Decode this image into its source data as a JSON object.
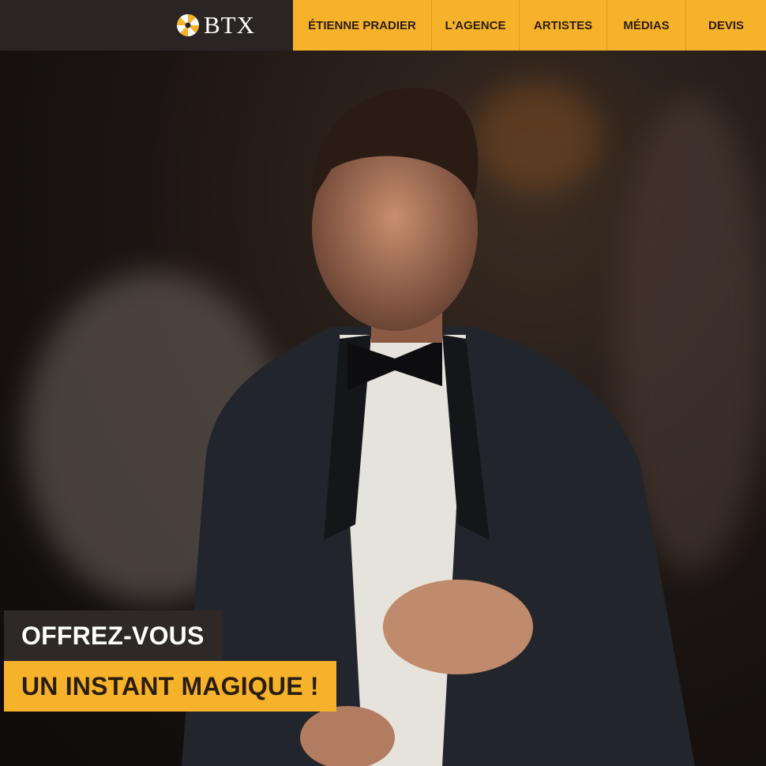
{
  "brand": {
    "logo_text": "BTX"
  },
  "nav": {
    "items": [
      {
        "label": "ÉTIENNE PRADIER"
      },
      {
        "label": "L'AGENCE"
      },
      {
        "label": "ARTISTES"
      },
      {
        "label": "MÉDIAS"
      },
      {
        "label": "DEVIS"
      }
    ]
  },
  "hero": {
    "line1": "OFFREZ-VOUS",
    "line2": "UN INSTANT MAGIQUE !"
  },
  "colors": {
    "accent": "#f6b22b",
    "header_dark": "#2a2424",
    "caption_dark": "#2e2826"
  },
  "icons": {
    "logo_mark": "shutter-flower-icon"
  }
}
